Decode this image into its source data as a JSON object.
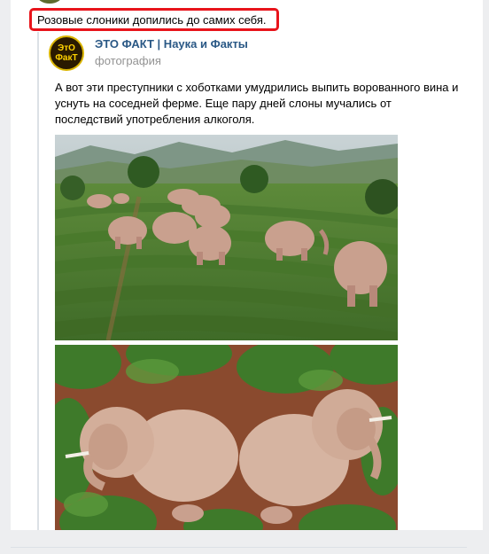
{
  "comment": {
    "text": "Розовые слоники допились до самих себя."
  },
  "source": {
    "avatar_line1": "ЭтО",
    "avatar_line2": "ФакТ",
    "name": "ЭТО ФАКТ | Наука и Факты",
    "subtitle": "фотография"
  },
  "post": {
    "text": "А вот эти преступники с хоботками умудрились выпить ворованного вина и уснуть на соседней ферме. Еще пару дней слоны мучались от последствий употребления алкоголя."
  },
  "colors": {
    "highlight_border": "#e8141b",
    "link": "#2a5885",
    "muted": "#939393"
  }
}
